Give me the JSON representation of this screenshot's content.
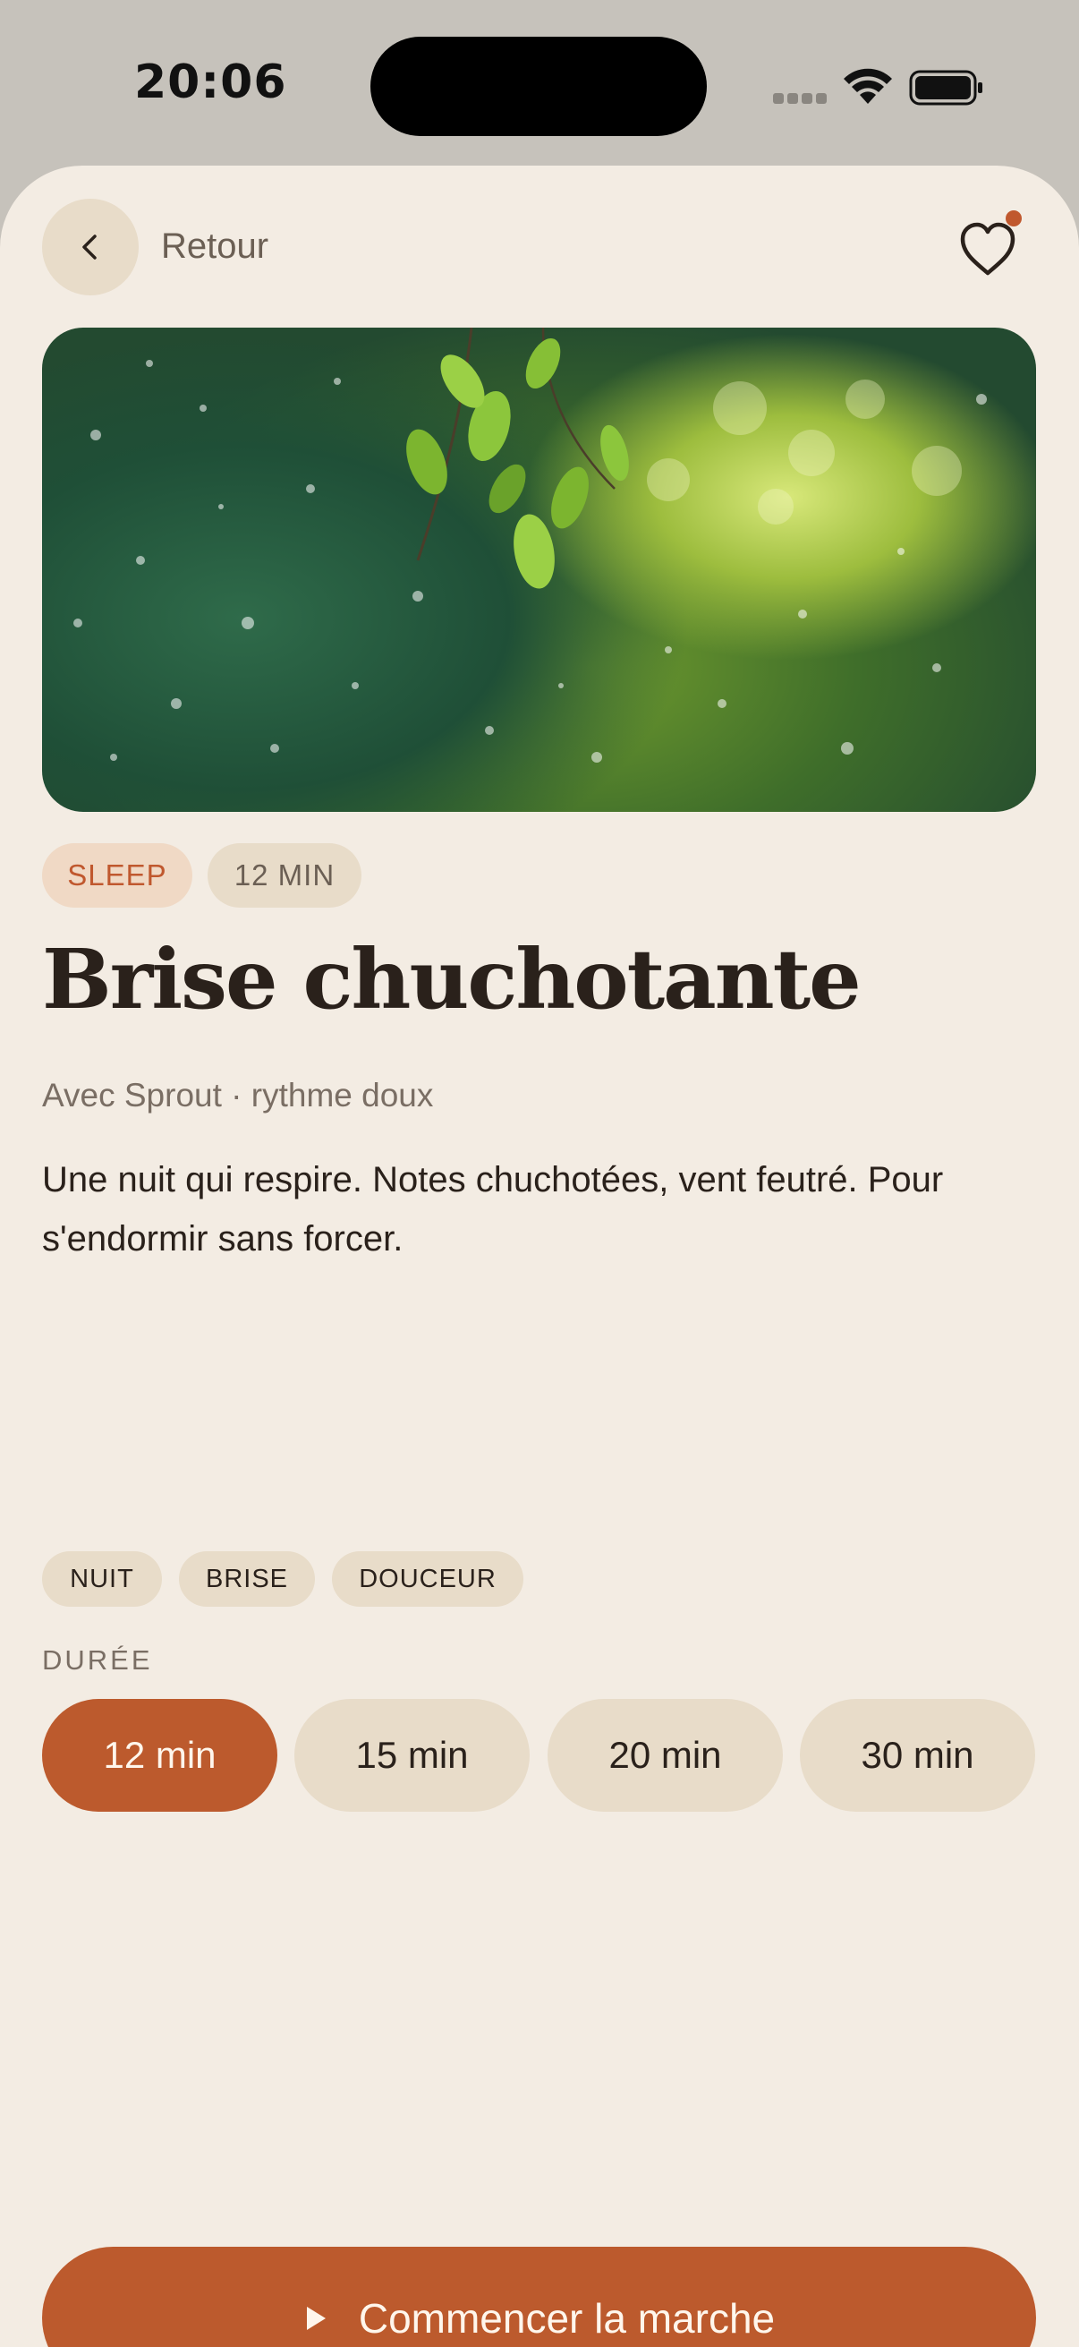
{
  "status_bar": {
    "time": "20:06"
  },
  "header": {
    "back_label": "Retour",
    "icons": {
      "back": "chevron-left-icon",
      "favorite": "heart-icon"
    },
    "favorite_dot_color": "#c0582e"
  },
  "hero": {
    "image": "green-leaves-bokeh-photo"
  },
  "chips": {
    "category": "SLEEP",
    "duration": "12 MIN"
  },
  "title": "Brise chuchotante",
  "subtitle": "Avec Sprout · rythme doux",
  "description": "Une nuit qui respire. Notes chuchotées, vent feutré. Pour s'endormir sans forcer.",
  "tags": [
    "NUIT",
    "BRISE",
    "DOUCEUR"
  ],
  "duration": {
    "label": "DURÉE",
    "options": [
      "12 min",
      "15 min",
      "20 min",
      "30 min"
    ],
    "selected": "12 min"
  },
  "cta": {
    "label": "Commencer la marche",
    "icon": "play-icon"
  },
  "colors": {
    "accent": "#bc5a2d",
    "background": "#f3ece3",
    "chip": "#e8dcc9",
    "text": "#2a211b"
  }
}
